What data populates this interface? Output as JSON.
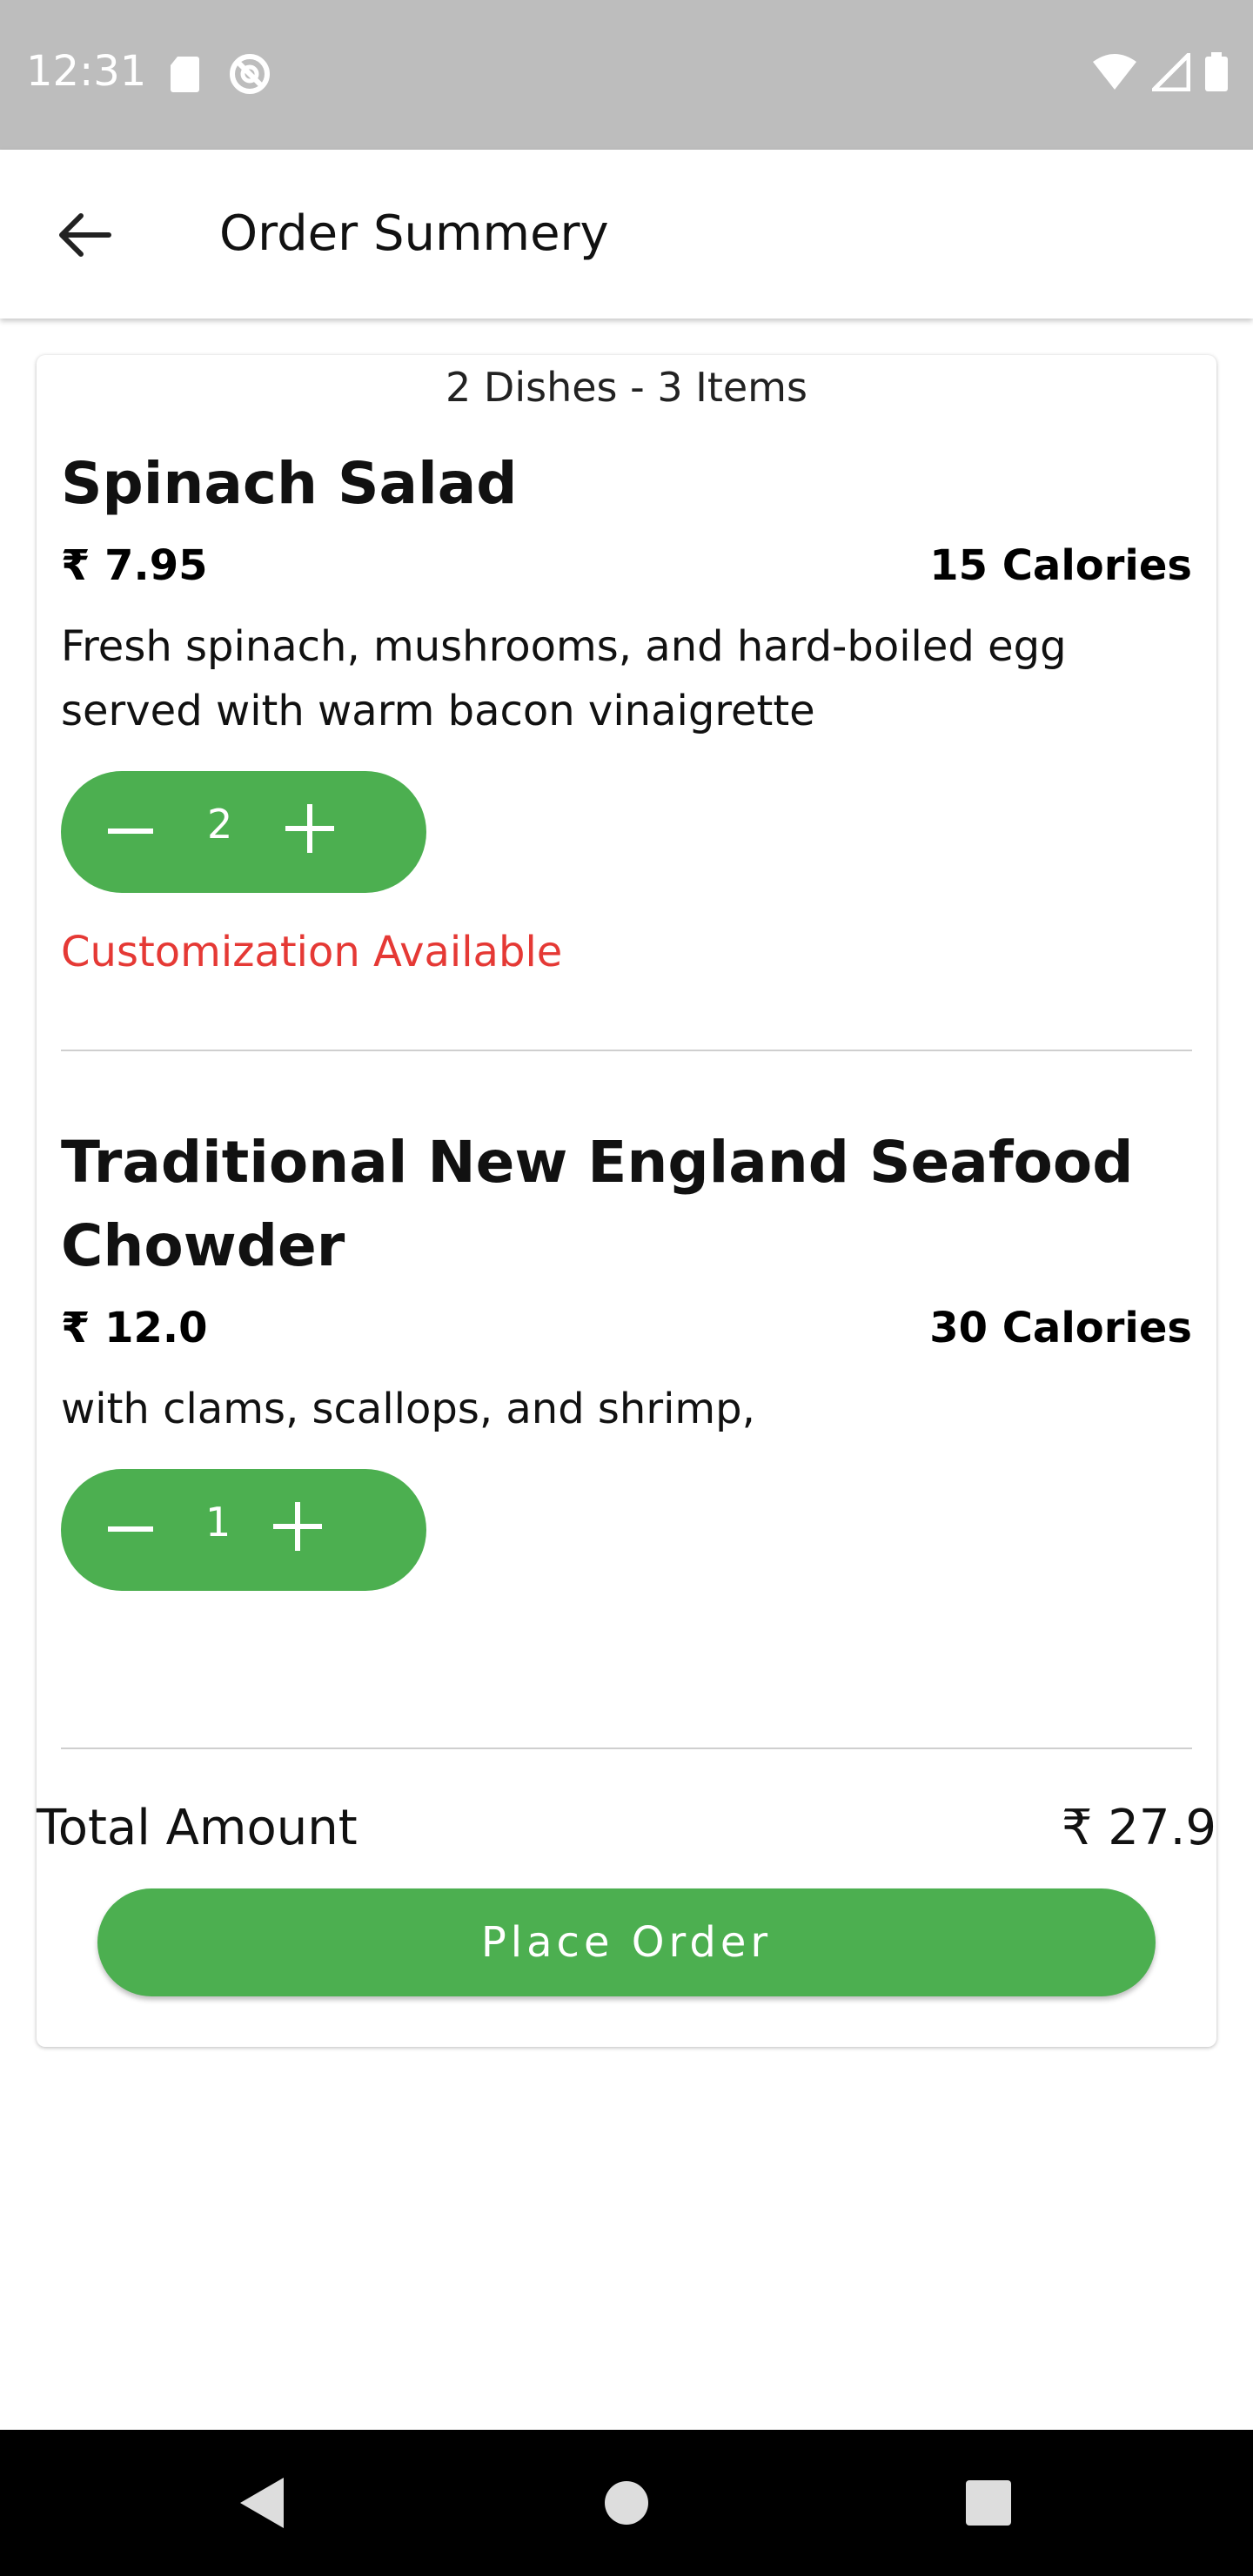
{
  "status_bar": {
    "time": "12:31",
    "icons_left": [
      "sd-card-icon",
      "no-sync-icon"
    ],
    "icons_right": [
      "wifi-icon",
      "cell-signal-icon",
      "battery-icon"
    ]
  },
  "app_bar": {
    "title": "Order Summery",
    "back_icon": "arrow-left-icon"
  },
  "order": {
    "summary": "2 Dishes - 3 Items",
    "dishes": [
      {
        "name": "Spinach Salad",
        "price": "₹ 7.95",
        "calories": "15 Calories",
        "description": "Fresh spinach, mushrooms, and hard-boiled egg served with warm bacon vinaigrette",
        "quantity": "2",
        "customization": "Customization Available"
      },
      {
        "name": "Traditional New England Seafood Chowder",
        "price": "₹ 12.0",
        "calories": "30 Calories",
        "description": "with clams, scallops, and shrimp,",
        "quantity": "1"
      }
    ],
    "total_label": "Total Amount",
    "total_value": "₹ 27.9",
    "place_order_label": "Place Order"
  },
  "colors": {
    "accent_green": "#4caf50",
    "customization_red": "#e53935",
    "status_bar_gray": "#bdbdbd"
  },
  "nav_bar": {
    "icons": [
      "back-triangle-icon",
      "home-circle-icon",
      "recents-square-icon"
    ]
  }
}
